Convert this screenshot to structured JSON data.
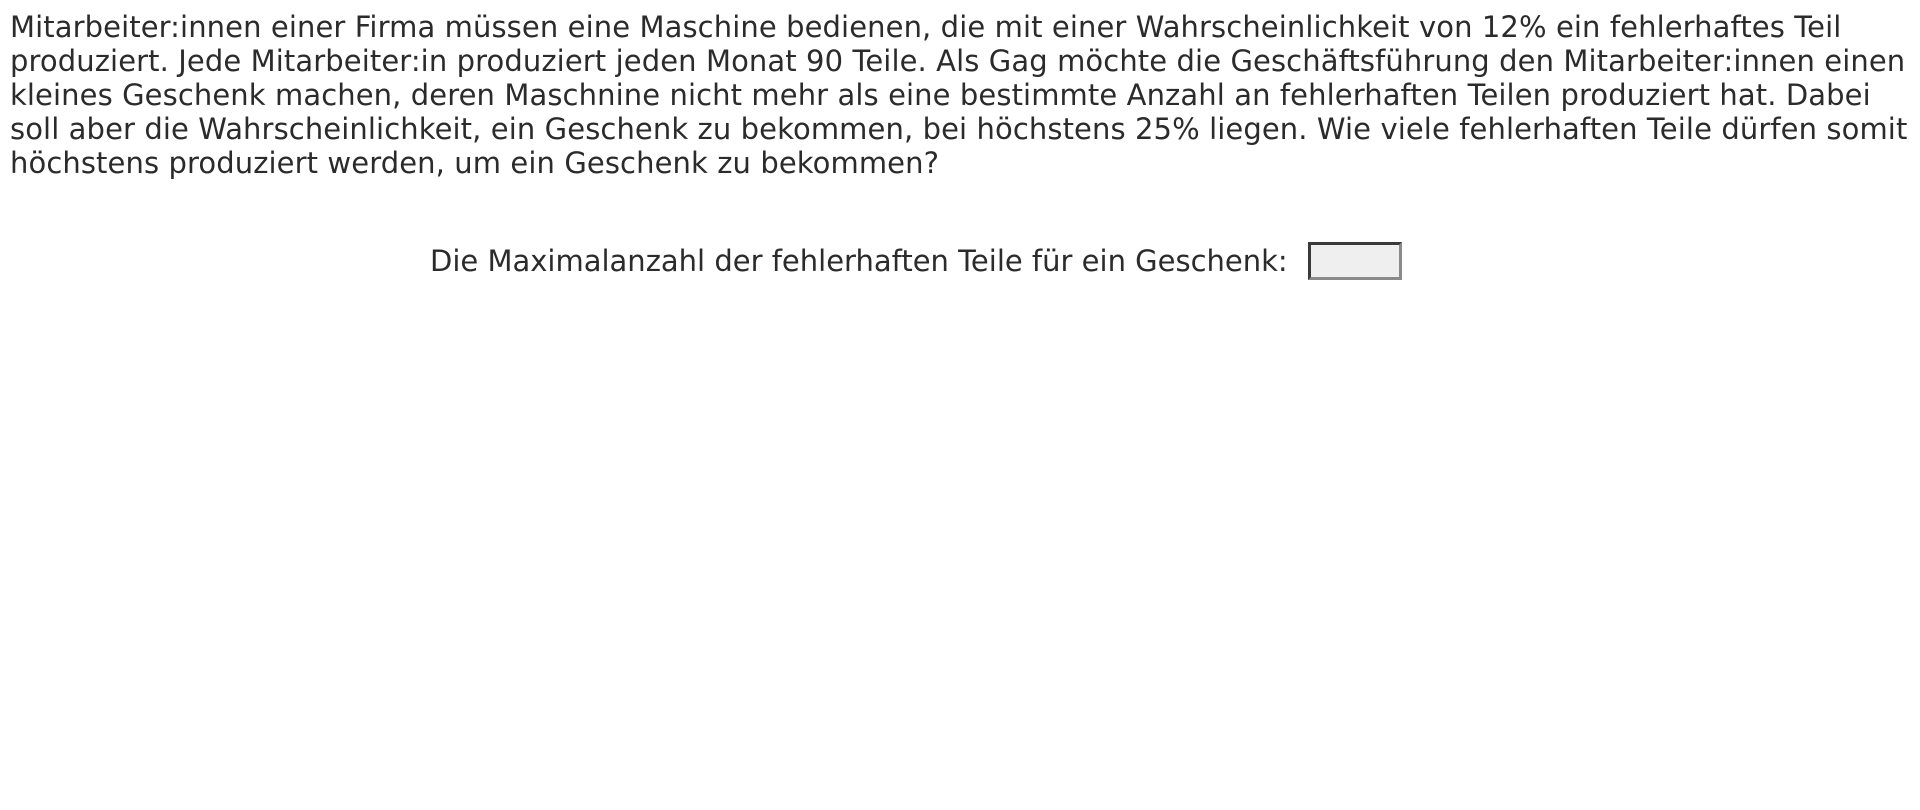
{
  "question": {
    "text": "Mitarbeiter:innen einer Firma müssen eine Maschine bedienen, die mit einer Wahrscheinlichkeit von 12% ein fehlerhaftes Teil produziert. Jede Mitarbeiter:in produziert jeden Monat 90 Teile. Als Gag möchte die Geschäftsführung den Mitarbeiter:innen einen kleines Geschenk machen, deren Maschnine nicht mehr als eine bestimmte Anzahl an fehlerhaften Teilen produziert hat. Dabei soll aber die Wahrscheinlichkeit, ein Geschenk zu bekommen, bei höchstens 25% liegen. Wie viele fehlerhaften Teile dürfen somit höchstens produziert werden, um ein Geschenk zu bekommen?"
  },
  "answer": {
    "label": "Die Maximalanzahl der fehlerhaften Teile für ein Geschenk:",
    "value": "",
    "placeholder": ""
  },
  "colors": {
    "text": "#2b2b2b",
    "input_background": "#efefef",
    "input_border_dark": "#3a3a3a",
    "input_border_light": "#8a8a8a"
  }
}
